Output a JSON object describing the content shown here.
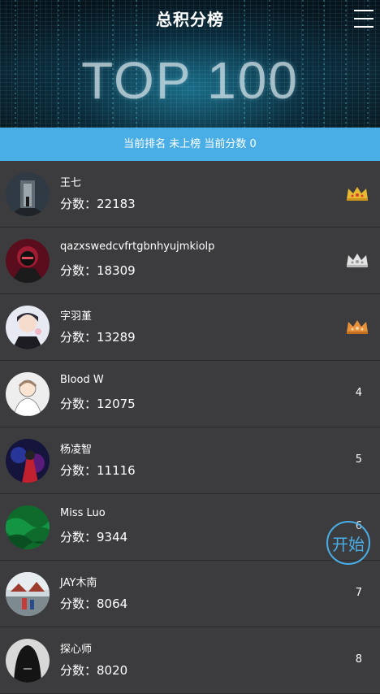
{
  "header": {
    "title": "总积分榜",
    "banner": "TOP 100",
    "menu_icon": "hamburger-menu-icon"
  },
  "status": {
    "text": "当前排名 未上榜  当前分数 0"
  },
  "colors": {
    "accent": "#4aaee6",
    "background": "#3c3c3f",
    "gold": "#e7b832",
    "silver": "#dcdcdc",
    "bronze": "#e8913a"
  },
  "rows": [
    {
      "name": "王七",
      "score": "分数：22183",
      "rank": "1",
      "crown": "gold"
    },
    {
      "name": "qazxswedcvfrtgbnhyujmkiolp",
      "score": "分数：18309",
      "rank": "2",
      "crown": "silver"
    },
    {
      "name": "字羽堇",
      "score": "分数：13289",
      "rank": "3",
      "crown": "bronze"
    },
    {
      "name": "Blood W",
      "score": "分数：12075",
      "rank": "4"
    },
    {
      "name": "杨凌智",
      "score": "分数：11116",
      "rank": "5"
    },
    {
      "name": "Miss Luo",
      "score": "分数：9344",
      "rank": "6"
    },
    {
      "name": "JAY木南",
      "score": "分数：8064",
      "rank": "7"
    },
    {
      "name": "探心师",
      "score": "分数：8020",
      "rank": "8"
    }
  ],
  "start_button": {
    "label": "开始"
  }
}
